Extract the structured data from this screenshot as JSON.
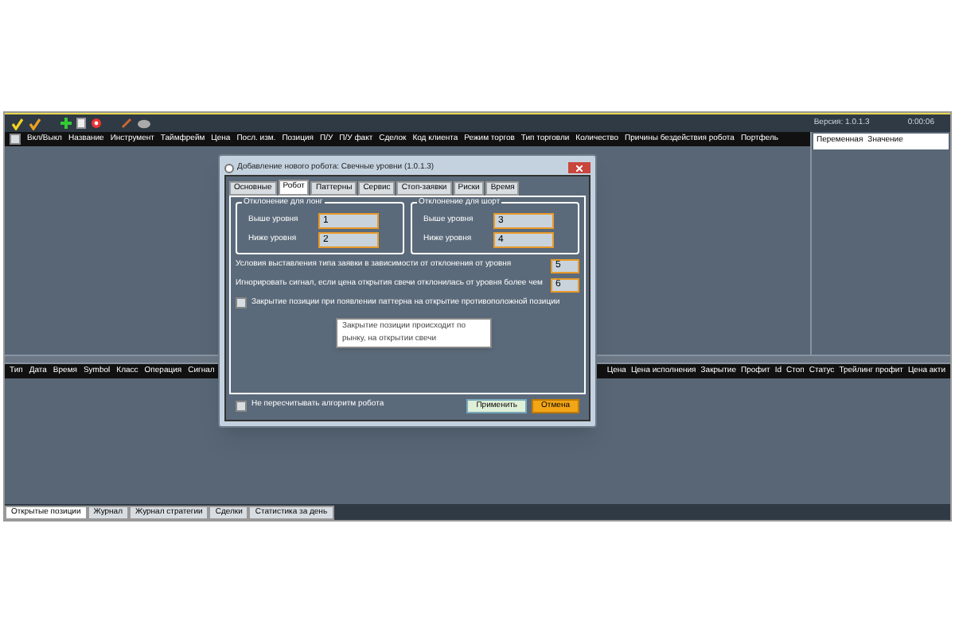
{
  "toolbar": {
    "version": "Версия: 1.0.1.3",
    "time": "0:00:06"
  },
  "robots_table": {
    "select_all_checked": false,
    "columns": [
      "Вкл/Выкл",
      "Название",
      "Инструмент",
      "Таймфрейм",
      "Цена",
      "Посл. изм.",
      "Позиция",
      "П/У",
      "П/У факт",
      "Сделок",
      "Код клиента",
      "Режим торгов",
      "Тип торговли",
      "Количество",
      "Причины бездействия робота",
      "Портфель"
    ]
  },
  "variables_table": {
    "columns": [
      "Переменная",
      "Значение"
    ]
  },
  "positions_table": {
    "columns_left": [
      "Тип",
      "Дата",
      "Время",
      "Symbol",
      "Класс",
      "Операция",
      "Сигнал"
    ],
    "columns_right": [
      "Цена",
      "Цена исполнения",
      "Закрытие",
      "Профит",
      "Id",
      "Стоп",
      "Статус",
      "Трейлинг профит",
      "Цена акти"
    ]
  },
  "bottom_tabs": [
    {
      "label": "Открытые позиции",
      "selected": true
    },
    {
      "label": "Журнал",
      "selected": false
    },
    {
      "label": "Журнал стратегии",
      "selected": false
    },
    {
      "label": "Сделки",
      "selected": false
    },
    {
      "label": "Статистика за день",
      "selected": false
    }
  ],
  "dialog": {
    "title": "Добавление нового робота: Свечные уровни (1.0.1.3)",
    "tabs": [
      {
        "label": "Основные",
        "selected": false
      },
      {
        "label": "Робот",
        "selected": true
      },
      {
        "label": "Паттерны",
        "selected": false
      },
      {
        "label": "Сервис",
        "selected": false
      },
      {
        "label": "Стоп-заявки",
        "selected": false
      },
      {
        "label": "Риски",
        "selected": false
      },
      {
        "label": "Время",
        "selected": false
      }
    ],
    "groups": [
      {
        "title": "Отклонение для лонг",
        "fields": [
          {
            "label": "Выше уровня",
            "value": "1"
          },
          {
            "label": "Ниже уровня",
            "value": "2"
          }
        ]
      },
      {
        "title": "Отклонение для шорт",
        "fields": [
          {
            "label": "Выше уровня",
            "value": "3"
          },
          {
            "label": "Ниже уровня",
            "value": "4"
          }
        ]
      }
    ],
    "rows": [
      {
        "label": "Условия выставления типа заявки в зависимости от отклонения от уровня",
        "value": "5"
      },
      {
        "label": "Игнорировать сигнал, если цена открытия свечи отклонилась от уровня более чем",
        "value": "6"
      }
    ],
    "close_checkbox": {
      "label": "Закрытие позиции при появлении паттерна на открытие противоположной позиции",
      "checked": false
    },
    "tooltip": "Закрытие позиции происходит по рынку, на открытии свечи",
    "footer_checkbox": {
      "label": "Не пересчитывать алгоритм робота",
      "checked": false
    },
    "buttons": [
      {
        "label": "Применить",
        "kind": "apply"
      },
      {
        "label": "Отмена",
        "kind": "cancel"
      }
    ]
  }
}
